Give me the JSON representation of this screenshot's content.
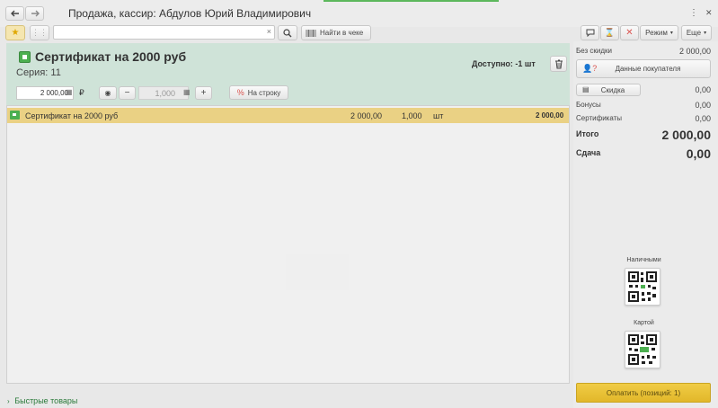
{
  "window": {
    "title": "Продажа, кассир: Абдулов Юрий Владимирович"
  },
  "toolbar": {
    "search_value": "",
    "find_in_receipt": "Найти в чеке",
    "mode": "Режим",
    "more": "Еще"
  },
  "product": {
    "name": "Сертификат на 2000 руб",
    "series": "Серия: 11",
    "available": "Доступно: -1 шт",
    "price": "2 000,00",
    "currency": "₽",
    "quantity": "1,000",
    "percent_button": "На строку"
  },
  "receipt": {
    "rows": [
      {
        "name": "Сертификат на 2000 руб",
        "price": "2 000,00",
        "qty": "1,000",
        "unit": "шт",
        "sum": "2 000,00"
      }
    ]
  },
  "summary": {
    "without_discount_label": "Без скидки",
    "without_discount_value": "2 000,00",
    "customer_data": "Данные покупателя",
    "discount_button": "Скидка",
    "discount_value": "0,00",
    "bonuses_label": "Бонусы",
    "bonuses_value": "0,00",
    "certificates_label": "Сертификаты",
    "certificates_value": "0,00",
    "total_label": "Итого",
    "total_value": "2 000,00",
    "change_label": "Сдача",
    "change_value": "0,00"
  },
  "payment": {
    "cash_label": "Наличными",
    "card_label": "Картой",
    "pay_button": "Оплатить (позиций: 1)"
  },
  "footer": {
    "quick_goods": "Быстрые товары"
  },
  "colors": {
    "accent_green": "#5cb85c",
    "product_panel": "#cfe3d8",
    "selected_row": "#ead184",
    "pay_button": "#e2b72a",
    "close_red": "#d9534f"
  }
}
